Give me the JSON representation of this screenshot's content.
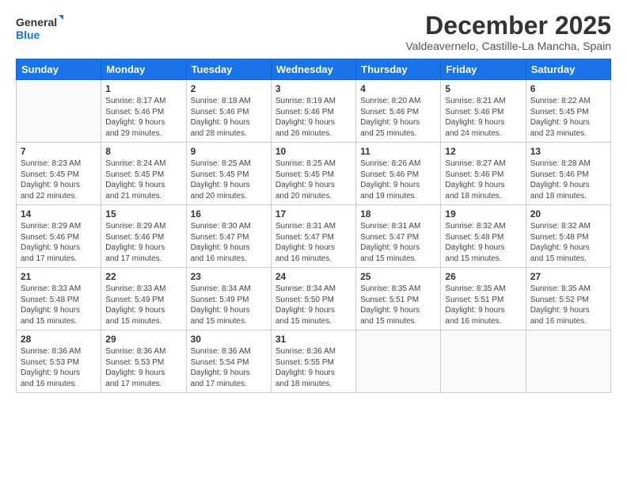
{
  "logo": {
    "line1": "General",
    "line2": "Blue"
  },
  "title": "December 2025",
  "location": "Valdeavernelo, Castille-La Mancha, Spain",
  "days_of_week": [
    "Sunday",
    "Monday",
    "Tuesday",
    "Wednesday",
    "Thursday",
    "Friday",
    "Saturday"
  ],
  "weeks": [
    [
      {
        "day": "",
        "info": ""
      },
      {
        "day": "1",
        "info": "Sunrise: 8:17 AM\nSunset: 5:46 PM\nDaylight: 9 hours\nand 29 minutes."
      },
      {
        "day": "2",
        "info": "Sunrise: 8:18 AM\nSunset: 5:46 PM\nDaylight: 9 hours\nand 28 minutes."
      },
      {
        "day": "3",
        "info": "Sunrise: 8:19 AM\nSunset: 5:46 PM\nDaylight: 9 hours\nand 26 minutes."
      },
      {
        "day": "4",
        "info": "Sunrise: 8:20 AM\nSunset: 5:46 PM\nDaylight: 9 hours\nand 25 minutes."
      },
      {
        "day": "5",
        "info": "Sunrise: 8:21 AM\nSunset: 5:46 PM\nDaylight: 9 hours\nand 24 minutes."
      },
      {
        "day": "6",
        "info": "Sunrise: 8:22 AM\nSunset: 5:45 PM\nDaylight: 9 hours\nand 23 minutes."
      }
    ],
    [
      {
        "day": "7",
        "info": "Sunrise: 8:23 AM\nSunset: 5:45 PM\nDaylight: 9 hours\nand 22 minutes."
      },
      {
        "day": "8",
        "info": "Sunrise: 8:24 AM\nSunset: 5:45 PM\nDaylight: 9 hours\nand 21 minutes."
      },
      {
        "day": "9",
        "info": "Sunrise: 8:25 AM\nSunset: 5:45 PM\nDaylight: 9 hours\nand 20 minutes."
      },
      {
        "day": "10",
        "info": "Sunrise: 8:25 AM\nSunset: 5:45 PM\nDaylight: 9 hours\nand 20 minutes."
      },
      {
        "day": "11",
        "info": "Sunrise: 8:26 AM\nSunset: 5:46 PM\nDaylight: 9 hours\nand 19 minutes."
      },
      {
        "day": "12",
        "info": "Sunrise: 8:27 AM\nSunset: 5:46 PM\nDaylight: 9 hours\nand 18 minutes."
      },
      {
        "day": "13",
        "info": "Sunrise: 8:28 AM\nSunset: 5:46 PM\nDaylight: 9 hours\nand 18 minutes."
      }
    ],
    [
      {
        "day": "14",
        "info": "Sunrise: 8:29 AM\nSunset: 5:46 PM\nDaylight: 9 hours\nand 17 minutes."
      },
      {
        "day": "15",
        "info": "Sunrise: 8:29 AM\nSunset: 5:46 PM\nDaylight: 9 hours\nand 17 minutes."
      },
      {
        "day": "16",
        "info": "Sunrise: 8:30 AM\nSunset: 5:47 PM\nDaylight: 9 hours\nand 16 minutes."
      },
      {
        "day": "17",
        "info": "Sunrise: 8:31 AM\nSunset: 5:47 PM\nDaylight: 9 hours\nand 16 minutes."
      },
      {
        "day": "18",
        "info": "Sunrise: 8:31 AM\nSunset: 5:47 PM\nDaylight: 9 hours\nand 15 minutes."
      },
      {
        "day": "19",
        "info": "Sunrise: 8:32 AM\nSunset: 5:48 PM\nDaylight: 9 hours\nand 15 minutes."
      },
      {
        "day": "20",
        "info": "Sunrise: 8:32 AM\nSunset: 5:48 PM\nDaylight: 9 hours\nand 15 minutes."
      }
    ],
    [
      {
        "day": "21",
        "info": "Sunrise: 8:33 AM\nSunset: 5:48 PM\nDaylight: 9 hours\nand 15 minutes."
      },
      {
        "day": "22",
        "info": "Sunrise: 8:33 AM\nSunset: 5:49 PM\nDaylight: 9 hours\nand 15 minutes."
      },
      {
        "day": "23",
        "info": "Sunrise: 8:34 AM\nSunset: 5:49 PM\nDaylight: 9 hours\nand 15 minutes."
      },
      {
        "day": "24",
        "info": "Sunrise: 8:34 AM\nSunset: 5:50 PM\nDaylight: 9 hours\nand 15 minutes."
      },
      {
        "day": "25",
        "info": "Sunrise: 8:35 AM\nSunset: 5:51 PM\nDaylight: 9 hours\nand 15 minutes."
      },
      {
        "day": "26",
        "info": "Sunrise: 8:35 AM\nSunset: 5:51 PM\nDaylight: 9 hours\nand 16 minutes."
      },
      {
        "day": "27",
        "info": "Sunrise: 8:35 AM\nSunset: 5:52 PM\nDaylight: 9 hours\nand 16 minutes."
      }
    ],
    [
      {
        "day": "28",
        "info": "Sunrise: 8:36 AM\nSunset: 5:53 PM\nDaylight: 9 hours\nand 16 minutes."
      },
      {
        "day": "29",
        "info": "Sunrise: 8:36 AM\nSunset: 5:53 PM\nDaylight: 9 hours\nand 17 minutes."
      },
      {
        "day": "30",
        "info": "Sunrise: 8:36 AM\nSunset: 5:54 PM\nDaylight: 9 hours\nand 17 minutes."
      },
      {
        "day": "31",
        "info": "Sunrise: 8:36 AM\nSunset: 5:55 PM\nDaylight: 9 hours\nand 18 minutes."
      },
      {
        "day": "",
        "info": ""
      },
      {
        "day": "",
        "info": ""
      },
      {
        "day": "",
        "info": ""
      }
    ]
  ]
}
